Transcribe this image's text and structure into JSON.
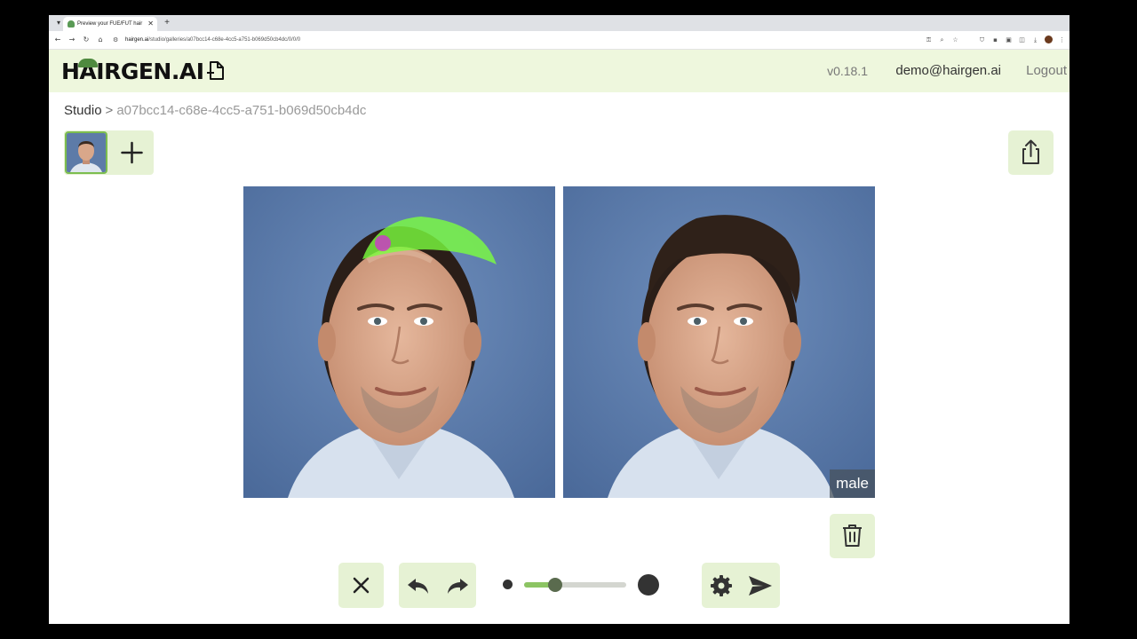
{
  "browser": {
    "tab_title": "Preview your FUE/FUT hair",
    "tab_close": "✕",
    "new_tab": "+",
    "url_host": "hairgen.ai",
    "url_path": "/studio/galleries/a07bcc14-c68e-4cc5-a751-b069d50cb4dc/0/0/0"
  },
  "header": {
    "logo": "HAIRGEN.AI",
    "version": "v0.18.1",
    "user_email": "demo@hairgen.ai",
    "logout": "Logout"
  },
  "breadcrumb": {
    "studio": "Studio",
    "separator": ">",
    "gallery_id": "a07bcc14-c68e-4cc5-a751-b069d50cb4dc"
  },
  "result": {
    "label": "male"
  },
  "brush_size": {
    "value_fraction": 0.3
  },
  "colors": {
    "header_bg": "#eef7dd",
    "button_bg": "#e6f2d4",
    "accent": "#8cc463",
    "mask": "#7cff3e"
  },
  "icons": [
    "new-document-icon",
    "plus-icon",
    "share-icon",
    "trash-icon",
    "close-icon",
    "undo-icon",
    "redo-icon",
    "gear-icon",
    "send-icon"
  ]
}
